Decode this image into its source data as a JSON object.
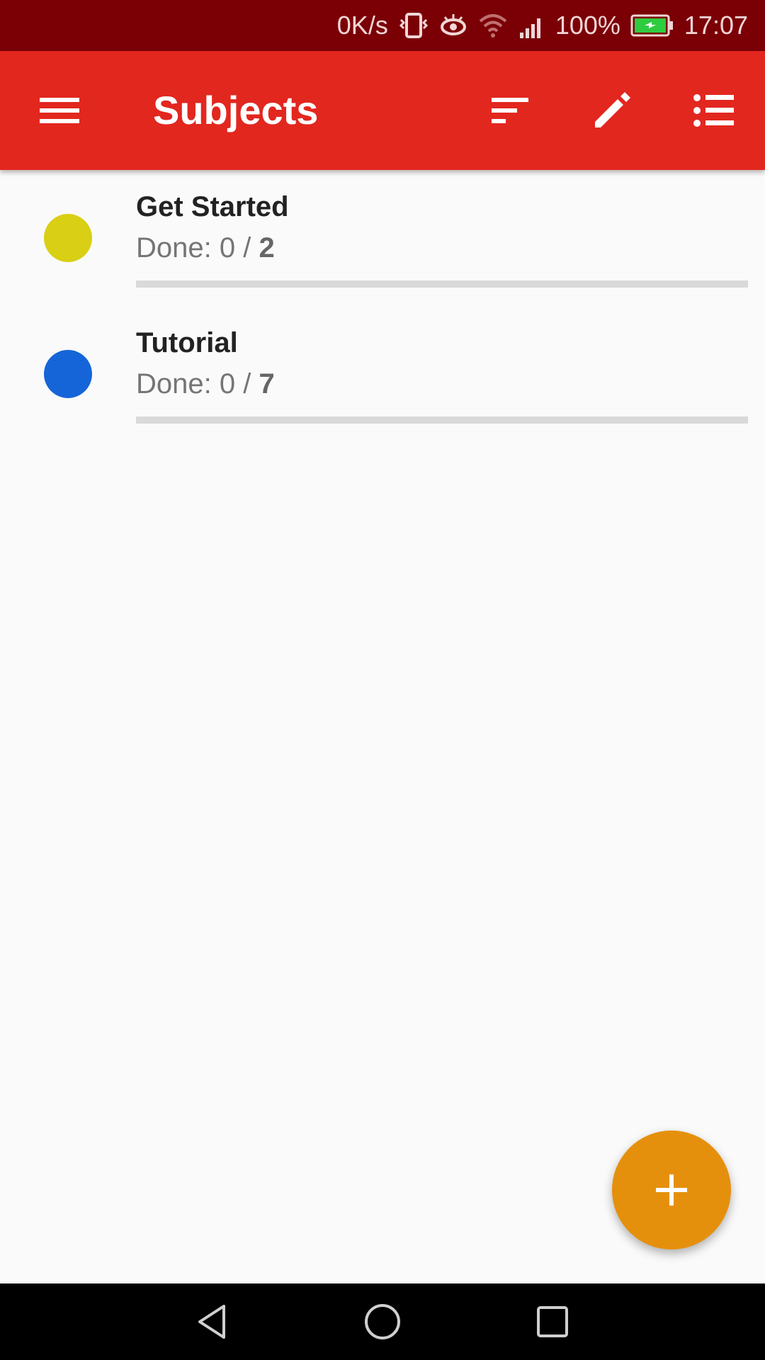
{
  "status_bar": {
    "speed": "0K/s",
    "battery": "100%",
    "time": "17:07",
    "icons": [
      "vibrate-icon",
      "eye-icon",
      "wifi-icon",
      "signal-icon",
      "battery-icon"
    ]
  },
  "app_bar": {
    "title": "Subjects",
    "icons": [
      "menu-icon",
      "sort-icon",
      "edit-icon",
      "list-icon"
    ],
    "color": "#e2271f"
  },
  "subjects": [
    {
      "title": "Get Started",
      "done_prefix": "Done: 0 / ",
      "total": "2",
      "color": "#d9cf14",
      "progress": 0
    },
    {
      "title": "Tutorial",
      "done_prefix": "Done: 0 / ",
      "total": "7",
      "color": "#1565d8",
      "progress": 0
    }
  ],
  "fab": {
    "icon": "add-icon",
    "color": "#e5900c"
  },
  "nav_bar": {
    "icons": [
      "back-icon",
      "home-icon",
      "recents-icon"
    ]
  }
}
